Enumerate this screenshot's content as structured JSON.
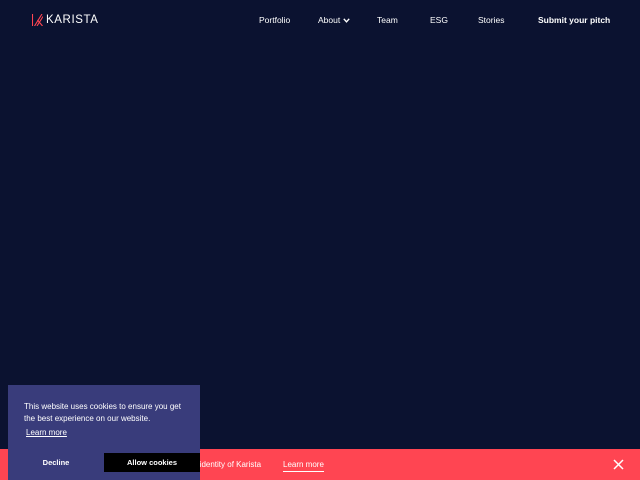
{
  "brand": {
    "logo_icon": "karista-k-icon",
    "name": "KARISTA"
  },
  "nav": {
    "items": [
      {
        "label": "Portfolio"
      },
      {
        "label": "About",
        "icon": "chevron-down-icon"
      },
      {
        "label": "Team"
      },
      {
        "label": "ESG"
      },
      {
        "label": "Stories"
      },
      {
        "label": "Submit your pitch"
      }
    ]
  },
  "announcement": {
    "text": "e identity of Karista",
    "link_label": "Learn more",
    "close_icon": "close-icon",
    "background": "#ff4552"
  },
  "cookie_banner": {
    "message": "This website uses cookies to ensure you get the best experience on our website.",
    "learn_more": "Learn more",
    "decline_label": "Decline",
    "allow_label": "Allow cookies",
    "background": "#393c7b"
  },
  "colors": {
    "page_background": "#0b1230",
    "accent": "#ff4552"
  }
}
